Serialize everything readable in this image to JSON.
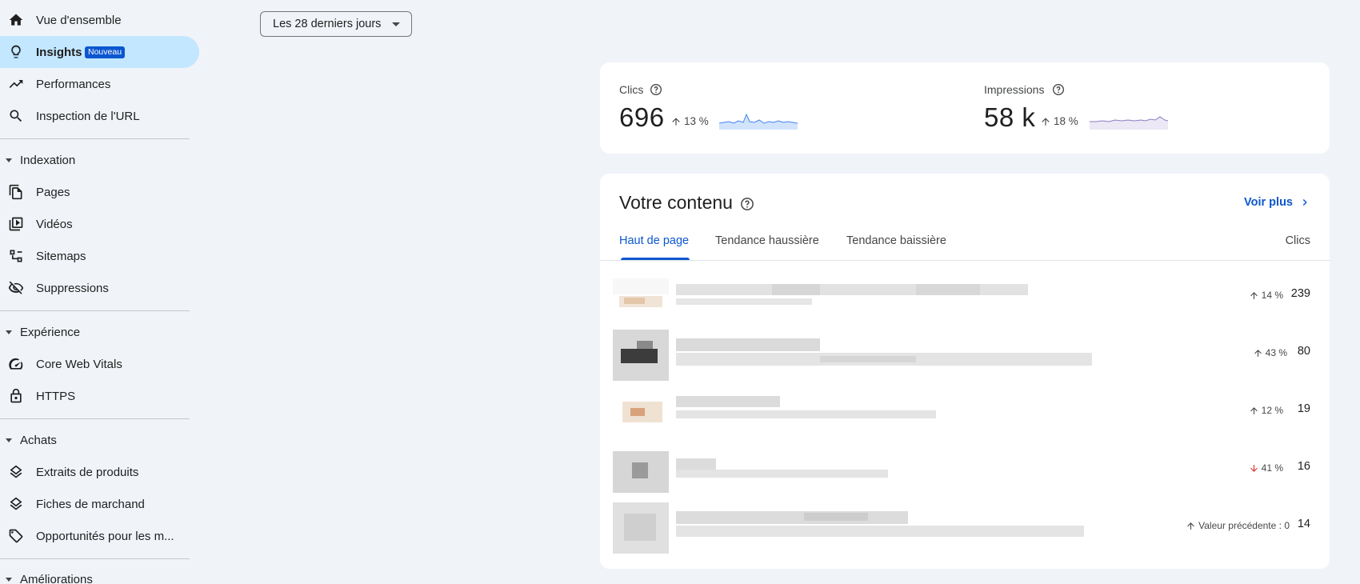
{
  "sidebar": {
    "items": [
      {
        "label": "Vue d'ensemble",
        "icon": "home-icon"
      },
      {
        "label": "Insights",
        "icon": "lightbulb-icon",
        "badge": "Nouveau",
        "active": true
      },
      {
        "label": "Performances",
        "icon": "trending-up-icon"
      },
      {
        "label": "Inspection de l'URL",
        "icon": "search-icon"
      }
    ],
    "sections": [
      {
        "title": "Indexation",
        "items": [
          {
            "label": "Pages",
            "icon": "pages-icon"
          },
          {
            "label": "Vidéos",
            "icon": "video-icon"
          },
          {
            "label": "Sitemaps",
            "icon": "sitemap-icon"
          },
          {
            "label": "Suppressions",
            "icon": "eye-off-icon"
          }
        ]
      },
      {
        "title": "Expérience",
        "items": [
          {
            "label": "Core Web Vitals",
            "icon": "gauge-icon"
          },
          {
            "label": "HTTPS",
            "icon": "lock-icon"
          }
        ]
      },
      {
        "title": "Achats",
        "items": [
          {
            "label": "Extraits de produits",
            "icon": "layers-icon"
          },
          {
            "label": "Fiches de marchand",
            "icon": "layers-icon"
          },
          {
            "label": "Opportunités pour les m...",
            "icon": "tag-icon"
          }
        ]
      },
      {
        "title": "Améliorations",
        "items": []
      }
    ]
  },
  "date_filter": {
    "label": "Les 28 derniers jours"
  },
  "metrics": {
    "clicks": {
      "label": "Clics",
      "value": "696",
      "delta": "13 %",
      "direction": "up",
      "color": "#4285f4"
    },
    "impressions": {
      "label": "Impressions",
      "value": "58 k",
      "delta": "18 %",
      "direction": "up",
      "color": "#8e7cc3"
    }
  },
  "content": {
    "title": "Votre contenu",
    "see_more": "Voir plus",
    "tabs": [
      "Haut de page",
      "Tendance haussière",
      "Tendance baissière"
    ],
    "clicks_header": "Clics",
    "rows": [
      {
        "delta": "14 %",
        "direction": "up",
        "value": "239"
      },
      {
        "delta": "43 %",
        "direction": "up",
        "value": "80"
      },
      {
        "delta": "12 %",
        "direction": "up",
        "value": "19"
      },
      {
        "delta": "41 %",
        "direction": "down",
        "value": "16"
      },
      {
        "delta": "Valeur précédente : 0",
        "direction": "up",
        "value": "14"
      }
    ]
  },
  "colors": {
    "accent": "#0b57d0",
    "active_nav": "#c2e7ff",
    "down": "#d93025"
  }
}
